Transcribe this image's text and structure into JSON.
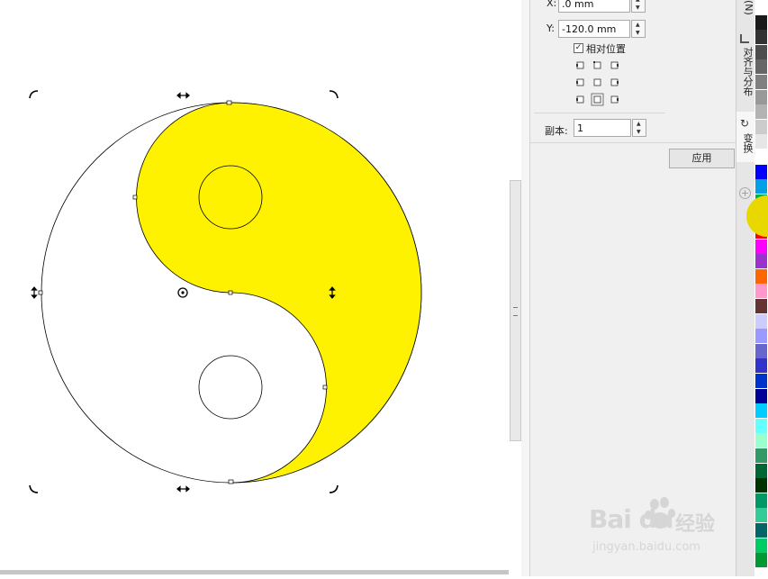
{
  "transform_panel": {
    "x_label": "X:",
    "x_value": ".0 mm",
    "y_label": "Y:",
    "y_value": "-120.0 mm",
    "relative_position_label": "相对位置",
    "relative_position_checked": true,
    "copies_label": "副本:",
    "copies_value": "1",
    "apply_label": "应用"
  },
  "docker_tabs": {
    "top_fragment": "(N)",
    "align_distribute": "对齐与分布",
    "transform": "变换"
  },
  "shape": {
    "name": "yin-yang",
    "fill_color": "#fff200",
    "outline_color": "#000000"
  },
  "palette": {
    "colors": [
      "#ffffff",
      "#1a1a1a",
      "#333333",
      "#4d4d4d",
      "#666666",
      "#808080",
      "#999999",
      "#b3b3b3",
      "#cccccc",
      "#e6e6e6",
      "#ffffff",
      "#0000ff",
      "#00a0e9",
      "#00b050",
      "#ffff00",
      "#ff0000",
      "#ff00ff",
      "#9933cc",
      "#ff6600",
      "#ff99cc",
      "#663333",
      "#ccccff",
      "#9999ff",
      "#6666cc",
      "#3333cc",
      "#0033cc",
      "#000099",
      "#00ccff",
      "#66ffff",
      "#99ffcc",
      "#339966",
      "#006633",
      "#003300",
      "#009966",
      "#33cc99",
      "#006666",
      "#00cc66",
      "#009933"
    ]
  },
  "watermark": {
    "brand": "Bai  du",
    "product": "经验",
    "url": "jingyan.baidu.com"
  }
}
